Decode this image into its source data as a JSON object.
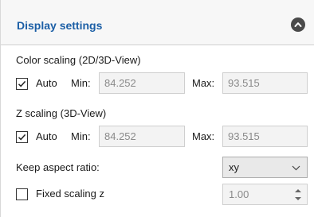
{
  "header": {
    "title": "Display settings",
    "collapse_icon": "chevron-up-icon"
  },
  "color_scaling": {
    "label": "Color scaling (2D/3D-View)",
    "auto_label": "Auto",
    "auto_checked": true,
    "min_label": "Min:",
    "min_value": "84.252",
    "max_label": "Max:",
    "max_value": "93.515"
  },
  "z_scaling": {
    "label": "Z scaling (3D-View)",
    "auto_label": "Auto",
    "auto_checked": true,
    "min_label": "Min:",
    "min_value": "84.252",
    "max_label": "Max:",
    "max_value": "93.515"
  },
  "aspect": {
    "label": "Keep aspect ratio:",
    "value": "xy"
  },
  "fixed_z": {
    "label": "Fixed scaling z",
    "checked": false,
    "value": "1.00"
  },
  "colors": {
    "title": "#1c5fa6",
    "header_bg": "#f7f7f7",
    "disabled_text": "#8a8a8a"
  }
}
